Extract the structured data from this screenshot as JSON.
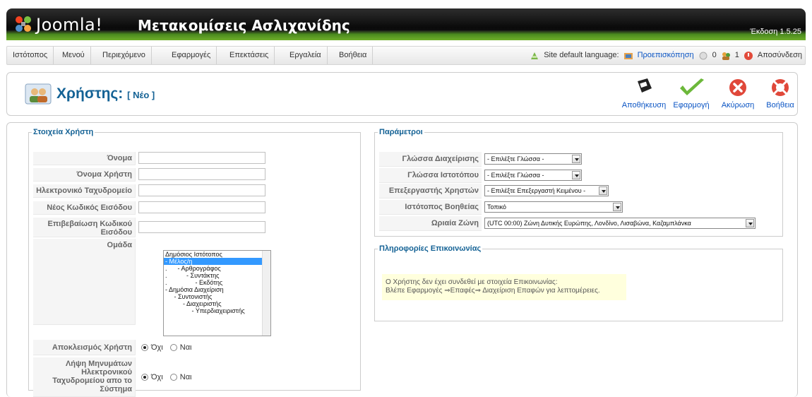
{
  "header": {
    "logo_text": "Joomla!",
    "site_title": "Μετακομίσεις Ασλιχανίδης",
    "version": "Έκδοση 1.5.25"
  },
  "menu": {
    "items": [
      {
        "label": "Ιστότοπος"
      },
      {
        "label": "Μενού"
      },
      {
        "label": "Περιεχόμενο"
      },
      {
        "label": "Εφαρμογές"
      },
      {
        "label": "Επεκτάσεις"
      },
      {
        "label": "Εργαλεία"
      },
      {
        "label": "Βοήθεια"
      }
    ],
    "status": {
      "site_default_language": "Site default language:",
      "preview": "Προεπισκόπηση",
      "messages_count": "0",
      "users_count": "1",
      "logout": "Αποσύνδεση"
    }
  },
  "toolbar": {
    "title": "Χρήστης:",
    "subtitle": "[ Νέο ]",
    "buttons": [
      {
        "label": "Αποθήκευση",
        "icon": "save-icon"
      },
      {
        "label": "Εφαρμογή",
        "icon": "apply-icon"
      },
      {
        "label": "Ακύρωση",
        "icon": "cancel-icon"
      },
      {
        "label": "Βοήθεια",
        "icon": "help-icon"
      }
    ]
  },
  "user_details": {
    "legend": "Στοιχεία Χρήστη",
    "fields": [
      {
        "label": "Όνομα",
        "value": ""
      },
      {
        "label": "Όνομα Χρήστη",
        "value": ""
      },
      {
        "label": "Ηλεκτρονικό Ταχυδρομείο",
        "value": ""
      },
      {
        "label": "Νέος Κωδικός Εισόδου",
        "value": ""
      },
      {
        "label": "Επιβεβαίωση Κωδικού Εισόδου",
        "value": ""
      }
    ],
    "group_label": "Ομάδα",
    "group_options": [
      {
        "text": "Δημόσιος Ιστότοπος",
        "selected": false
      },
      {
        "text": "- Μέλος/η",
        "selected": true
      },
      {
        "text": ".      - Αρθρογράφος",
        "selected": false
      },
      {
        "text": ".           - Συντάκτης",
        "selected": false
      },
      {
        "text": ".                - Εκδότης",
        "selected": false
      },
      {
        "text": "- Δημόσια Διαχείριση",
        "selected": false
      },
      {
        "text": "     - Συντονιστής",
        "selected": false
      },
      {
        "text": "          - Διαχειριστής",
        "selected": false
      },
      {
        "text": "               - Υπερδιαχειριστής",
        "selected": false
      }
    ],
    "block_label": "Αποκλεισμός Χρήστη",
    "receive_label": "Λήψη Μηνυμάτων Ηλεκτρονικού Ταχυδρομείου απο το Σύστημα",
    "no": "Όχι",
    "yes": "Ναι"
  },
  "parameters": {
    "legend": "Παράμετροι",
    "rows": [
      {
        "label": "Γλώσσα Διαχείρισης",
        "value": "- Επιλέξτε Γλώσσα -"
      },
      {
        "label": "Γλώσσα Ιστοτόπου",
        "value": "- Επιλέξτε Γλώσσα -"
      },
      {
        "label": "Επεξεργαστής Χρηστών",
        "value": "- Επιλέξτε Επεξεργαστή Κειμένου -"
      },
      {
        "label": "Ιστότοπος Βοηθείας",
        "value": "Τοπικό"
      },
      {
        "label": "Ωριαία Ζώνη",
        "value": "(UTC 00:00) Ζώνη Δυτικής Ευρώπης, Λονδίνο, Λισαβώνα, Καζαμπλάνκα"
      }
    ]
  },
  "contact": {
    "legend": "Πληροφορίες Επικοινωνίας",
    "line1": "Ο Χρήστης δεν έχει συνδεθεί με στοιχεία Επικοινωνίας:",
    "line2": "Βλέπε Εφαρμογές ⇒Επαφές⇒ Διαχείριση Επαφών για λεπτομέρειες."
  }
}
